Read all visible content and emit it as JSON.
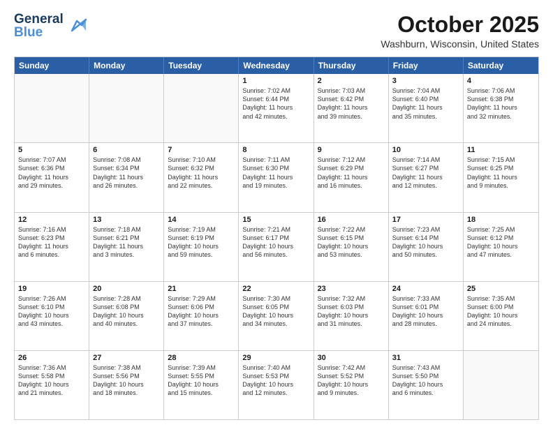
{
  "header": {
    "logo_line1": "General",
    "logo_line2": "Blue",
    "month_title": "October 2025",
    "location": "Washburn, Wisconsin, United States"
  },
  "day_headers": [
    "Sunday",
    "Monday",
    "Tuesday",
    "Wednesday",
    "Thursday",
    "Friday",
    "Saturday"
  ],
  "weeks": [
    [
      {
        "num": "",
        "info": ""
      },
      {
        "num": "",
        "info": ""
      },
      {
        "num": "",
        "info": ""
      },
      {
        "num": "1",
        "info": "Sunrise: 7:02 AM\nSunset: 6:44 PM\nDaylight: 11 hours\nand 42 minutes."
      },
      {
        "num": "2",
        "info": "Sunrise: 7:03 AM\nSunset: 6:42 PM\nDaylight: 11 hours\nand 39 minutes."
      },
      {
        "num": "3",
        "info": "Sunrise: 7:04 AM\nSunset: 6:40 PM\nDaylight: 11 hours\nand 35 minutes."
      },
      {
        "num": "4",
        "info": "Sunrise: 7:06 AM\nSunset: 6:38 PM\nDaylight: 11 hours\nand 32 minutes."
      }
    ],
    [
      {
        "num": "5",
        "info": "Sunrise: 7:07 AM\nSunset: 6:36 PM\nDaylight: 11 hours\nand 29 minutes."
      },
      {
        "num": "6",
        "info": "Sunrise: 7:08 AM\nSunset: 6:34 PM\nDaylight: 11 hours\nand 26 minutes."
      },
      {
        "num": "7",
        "info": "Sunrise: 7:10 AM\nSunset: 6:32 PM\nDaylight: 11 hours\nand 22 minutes."
      },
      {
        "num": "8",
        "info": "Sunrise: 7:11 AM\nSunset: 6:30 PM\nDaylight: 11 hours\nand 19 minutes."
      },
      {
        "num": "9",
        "info": "Sunrise: 7:12 AM\nSunset: 6:29 PM\nDaylight: 11 hours\nand 16 minutes."
      },
      {
        "num": "10",
        "info": "Sunrise: 7:14 AM\nSunset: 6:27 PM\nDaylight: 11 hours\nand 12 minutes."
      },
      {
        "num": "11",
        "info": "Sunrise: 7:15 AM\nSunset: 6:25 PM\nDaylight: 11 hours\nand 9 minutes."
      }
    ],
    [
      {
        "num": "12",
        "info": "Sunrise: 7:16 AM\nSunset: 6:23 PM\nDaylight: 11 hours\nand 6 minutes."
      },
      {
        "num": "13",
        "info": "Sunrise: 7:18 AM\nSunset: 6:21 PM\nDaylight: 11 hours\nand 3 minutes."
      },
      {
        "num": "14",
        "info": "Sunrise: 7:19 AM\nSunset: 6:19 PM\nDaylight: 10 hours\nand 59 minutes."
      },
      {
        "num": "15",
        "info": "Sunrise: 7:21 AM\nSunset: 6:17 PM\nDaylight: 10 hours\nand 56 minutes."
      },
      {
        "num": "16",
        "info": "Sunrise: 7:22 AM\nSunset: 6:15 PM\nDaylight: 10 hours\nand 53 minutes."
      },
      {
        "num": "17",
        "info": "Sunrise: 7:23 AM\nSunset: 6:14 PM\nDaylight: 10 hours\nand 50 minutes."
      },
      {
        "num": "18",
        "info": "Sunrise: 7:25 AM\nSunset: 6:12 PM\nDaylight: 10 hours\nand 47 minutes."
      }
    ],
    [
      {
        "num": "19",
        "info": "Sunrise: 7:26 AM\nSunset: 6:10 PM\nDaylight: 10 hours\nand 43 minutes."
      },
      {
        "num": "20",
        "info": "Sunrise: 7:28 AM\nSunset: 6:08 PM\nDaylight: 10 hours\nand 40 minutes."
      },
      {
        "num": "21",
        "info": "Sunrise: 7:29 AM\nSunset: 6:06 PM\nDaylight: 10 hours\nand 37 minutes."
      },
      {
        "num": "22",
        "info": "Sunrise: 7:30 AM\nSunset: 6:05 PM\nDaylight: 10 hours\nand 34 minutes."
      },
      {
        "num": "23",
        "info": "Sunrise: 7:32 AM\nSunset: 6:03 PM\nDaylight: 10 hours\nand 31 minutes."
      },
      {
        "num": "24",
        "info": "Sunrise: 7:33 AM\nSunset: 6:01 PM\nDaylight: 10 hours\nand 28 minutes."
      },
      {
        "num": "25",
        "info": "Sunrise: 7:35 AM\nSunset: 6:00 PM\nDaylight: 10 hours\nand 24 minutes."
      }
    ],
    [
      {
        "num": "26",
        "info": "Sunrise: 7:36 AM\nSunset: 5:58 PM\nDaylight: 10 hours\nand 21 minutes."
      },
      {
        "num": "27",
        "info": "Sunrise: 7:38 AM\nSunset: 5:56 PM\nDaylight: 10 hours\nand 18 minutes."
      },
      {
        "num": "28",
        "info": "Sunrise: 7:39 AM\nSunset: 5:55 PM\nDaylight: 10 hours\nand 15 minutes."
      },
      {
        "num": "29",
        "info": "Sunrise: 7:40 AM\nSunset: 5:53 PM\nDaylight: 10 hours\nand 12 minutes."
      },
      {
        "num": "30",
        "info": "Sunrise: 7:42 AM\nSunset: 5:52 PM\nDaylight: 10 hours\nand 9 minutes."
      },
      {
        "num": "31",
        "info": "Sunrise: 7:43 AM\nSunset: 5:50 PM\nDaylight: 10 hours\nand 6 minutes."
      },
      {
        "num": "",
        "info": ""
      }
    ]
  ]
}
